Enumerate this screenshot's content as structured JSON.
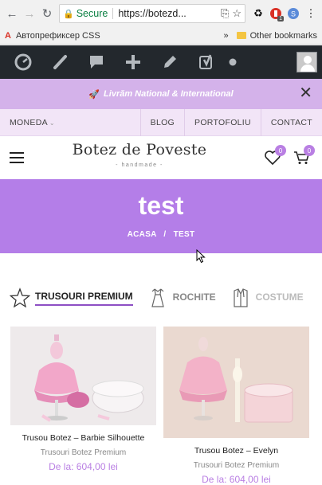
{
  "browser": {
    "secure_label": "Secure",
    "url": "https://botezd...",
    "extension_badge": "1",
    "extension_letter": "S"
  },
  "bookmarks": {
    "first_item": "Автопрефиксер CSS",
    "overflow": "»",
    "other": "Other bookmarks"
  },
  "announcement": {
    "text": "Livrăm National & International"
  },
  "topnav": {
    "currency": "MONEDA",
    "links": [
      "BLOG",
      "PORTOFOLIU",
      "CONTACT"
    ]
  },
  "header": {
    "logo": "Botez de Poveste",
    "logo_sub": "- handmade -",
    "wishlist_count": "0",
    "cart_count": "0"
  },
  "hero": {
    "title": "test",
    "breadcrumb_home": "ACASA",
    "breadcrumb_sep": "/",
    "breadcrumb_current": "TEST"
  },
  "tabs": [
    {
      "label": "TRUSOURI PREMIUM",
      "icon": "star-icon"
    },
    {
      "label": "ROCHITE",
      "icon": "dress-icon"
    },
    {
      "label": "COSTUME",
      "icon": "suit-icon"
    }
  ],
  "products": [
    {
      "name": "Trusou Botez – Barbie Silhouette",
      "category": "Trusouri Botez Premium",
      "price": "De la: 604,00 lei"
    },
    {
      "name": "Trusou Botez – Evelyn",
      "category": "Trusouri Botez Premium",
      "price": "De la: 604,00 lei"
    }
  ],
  "colors": {
    "accent": "#b47ee8",
    "notice": "#d4b2ea",
    "topnav": "#f2e5f7",
    "admin_bar": "#23282d"
  }
}
